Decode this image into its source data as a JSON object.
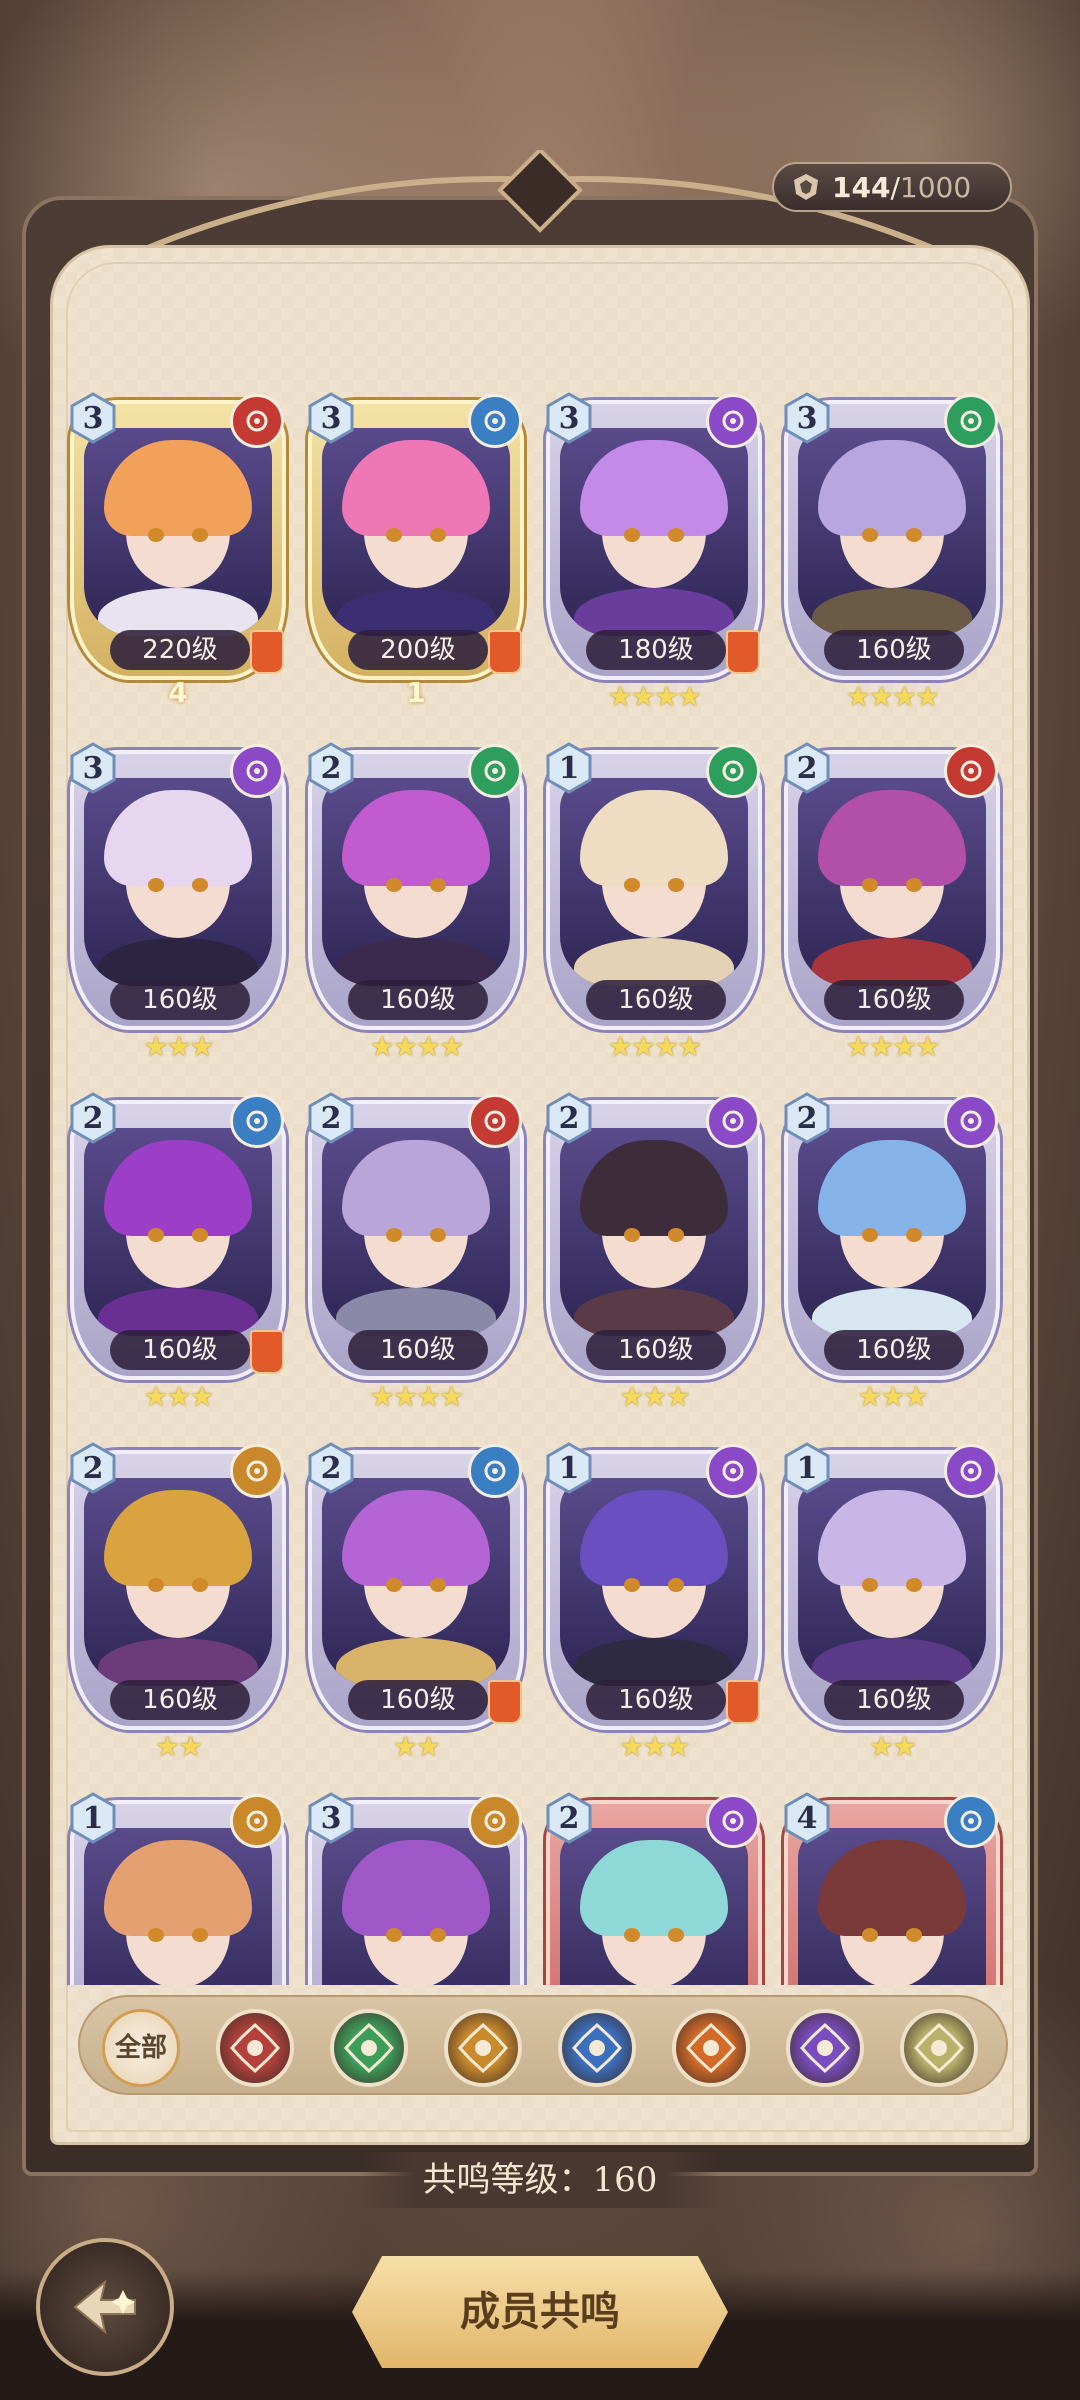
{
  "counter": {
    "current": "144",
    "separator": "/",
    "max": "1000",
    "icon": "crest-icon"
  },
  "cards": [
    {
      "count": "3",
      "level": "220级",
      "element": "fire",
      "stars": 0,
      "awaken": "4",
      "role": true,
      "theme": "gold",
      "hair": "#f2a15a",
      "body": "#e9e3f0"
    },
    {
      "count": "3",
      "level": "200级",
      "element": "water",
      "stars": 0,
      "awaken": "1",
      "role": true,
      "theme": "gold",
      "hair": "#ef77b6",
      "body": "#3b2f72"
    },
    {
      "count": "3",
      "level": "180级",
      "element": "void",
      "stars": 4,
      "awaken": "",
      "role": true,
      "theme": "purple",
      "hair": "#c48ae8",
      "body": "#6a3d9c"
    },
    {
      "count": "3",
      "level": "160级",
      "element": "nature",
      "stars": 4,
      "awaken": "",
      "role": false,
      "theme": "purple",
      "hair": "#b7a6df",
      "body": "#6b5a46"
    },
    {
      "count": "3",
      "level": "160级",
      "element": "void",
      "stars": 3,
      "awaken": "",
      "role": false,
      "theme": "purple",
      "hair": "#e7d6f0",
      "body": "#2c2440"
    },
    {
      "count": "2",
      "level": "160级",
      "element": "nature",
      "stars": 4,
      "awaken": "",
      "role": false,
      "theme": "purple",
      "hair": "#c25ad0",
      "body": "#3a2a4e"
    },
    {
      "count": "1",
      "level": "160级",
      "element": "nature",
      "stars": 4,
      "awaken": "",
      "role": false,
      "theme": "purple",
      "hair": "#eedcc3",
      "body": "#e4d2b6"
    },
    {
      "count": "2",
      "level": "160级",
      "element": "fire",
      "stars": 4,
      "awaken": "",
      "role": false,
      "theme": "purple",
      "hair": "#b24fa8",
      "body": "#a8343c"
    },
    {
      "count": "2",
      "level": "160级",
      "element": "water",
      "stars": 3,
      "awaken": "",
      "role": true,
      "theme": "purple",
      "hair": "#9d3ec9",
      "body": "#6a2f92"
    },
    {
      "count": "2",
      "level": "160级",
      "element": "fire",
      "stars": 4,
      "awaken": "",
      "role": false,
      "theme": "purple",
      "hair": "#b9a5d8",
      "body": "#8a8aa8"
    },
    {
      "count": "2",
      "level": "160级",
      "element": "void",
      "stars": 3,
      "awaken": "",
      "role": false,
      "theme": "purple",
      "hair": "#3d2c3a",
      "body": "#5a3a46"
    },
    {
      "count": "2",
      "level": "160级",
      "element": "void",
      "stars": 3,
      "awaken": "",
      "role": false,
      "theme": "purple",
      "hair": "#86b4e8",
      "body": "#d8e6f2"
    },
    {
      "count": "2",
      "level": "160级",
      "element": "earth",
      "stars": 2,
      "awaken": "",
      "role": false,
      "theme": "purple",
      "hair": "#d9a340",
      "body": "#6b3b7a"
    },
    {
      "count": "2",
      "level": "160级",
      "element": "water",
      "stars": 2,
      "awaken": "",
      "role": true,
      "theme": "purple",
      "hair": "#b464d4",
      "body": "#d9b36a"
    },
    {
      "count": "1",
      "level": "160级",
      "element": "void",
      "stars": 3,
      "awaken": "",
      "role": true,
      "theme": "purple",
      "hair": "#6a4fc0",
      "body": "#2e2a44"
    },
    {
      "count": "1",
      "level": "160级",
      "element": "void",
      "stars": 2,
      "awaken": "",
      "role": false,
      "theme": "purple",
      "hair": "#c8b6e6",
      "body": "#5a3a86"
    },
    {
      "count": "1",
      "level": "",
      "element": "earth",
      "stars": 0,
      "awaken": "",
      "role": false,
      "theme": "purple",
      "hair": "#e4a070",
      "body": "#8a6ac0"
    },
    {
      "count": "3",
      "level": "",
      "element": "earth",
      "stars": 0,
      "awaken": "",
      "role": false,
      "theme": "purple",
      "hair": "#a058c8",
      "body": "#503070"
    },
    {
      "count": "2",
      "level": "",
      "element": "void",
      "stars": 0,
      "awaken": "",
      "role": false,
      "theme": "red",
      "hair": "#8fd8d8",
      "body": "#3b9ab0"
    },
    {
      "count": "4",
      "level": "",
      "element": "water",
      "stars": 0,
      "awaken": "",
      "role": false,
      "theme": "red",
      "hair": "#7a3a3a",
      "body": "#a46ad0"
    }
  ],
  "element_colors": {
    "fire": "#c43a32",
    "water": "#3a7fc4",
    "void": "#8a4ac8",
    "nature": "#2e9e5e",
    "earth": "#c9882a"
  },
  "filters": [
    {
      "label": "全部",
      "icon": "all-filter"
    },
    {
      "icon": "fire-faction-icon",
      "color": "#b3403a"
    },
    {
      "icon": "nature-faction-icon",
      "color": "#3d9e5a"
    },
    {
      "icon": "earth-faction-icon",
      "color": "#c98a2c"
    },
    {
      "icon": "water-faction-icon",
      "color": "#3b6fbf"
    },
    {
      "icon": "flame-faction-icon",
      "color": "#d46a28"
    },
    {
      "icon": "void-faction-icon",
      "color": "#7a4cc0"
    },
    {
      "icon": "light-faction-icon",
      "color": "#b9b06a"
    }
  ],
  "resonance": {
    "label": "共鸣等级：",
    "value": "160"
  },
  "main_button": {
    "label": "成员共鸣"
  },
  "back_button": {
    "icon": "back-arrow-icon"
  }
}
